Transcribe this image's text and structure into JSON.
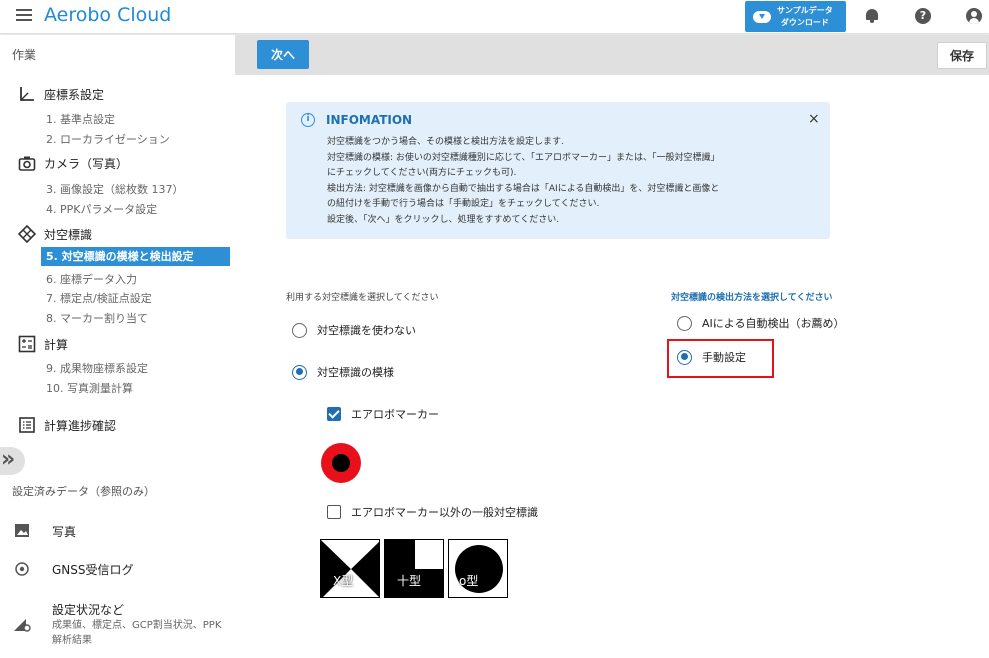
{
  "header": {
    "title": "Aerobo Cloud",
    "download_label_1": "サンプルデータ",
    "download_label_2": "ダウンロード",
    "help_glyph": "?"
  },
  "sidebar": {
    "work_title": "作業",
    "groups": [
      {
        "label": "座標系設定",
        "icon": "axis-icon",
        "items": [
          "1. 基準点設定",
          "2. ローカライゼーション"
        ]
      },
      {
        "label": "カメラ（写真）",
        "icon": "camera-icon",
        "items": [
          "3. 画像設定（総枚数 137）",
          "4. PPKパラメータ設定"
        ]
      },
      {
        "label": "対空標識",
        "icon": "target-icon",
        "items": [
          "5. 対空標識の模様と検出設定",
          "6. 座標データ入力",
          "7. 標定点/検証点設定",
          "8. マーカー割り当て"
        ]
      },
      {
        "label": "計算",
        "icon": "calculator-icon",
        "items": [
          "9. 成果物座標系設定",
          "10. 写真測量計算"
        ]
      }
    ],
    "progress_label": "計算進捗確認",
    "reference_title": "設定済みデータ（参照のみ）",
    "reference": {
      "photo": "写真",
      "gnss": "GNSS受信ログ",
      "settings": "設定状況など",
      "settings_sub": "成果値、標定点、GCP割当状況、PPK解析結果"
    }
  },
  "toolbar": {
    "next_label": "次へ",
    "save_label": "保存"
  },
  "info": {
    "title": "INFOMATION",
    "close": "×",
    "lines": [
      "対空標識をつかう場合、その模様と検出方法を設定します.",
      "対空標識の模様: お使いの対空標識種別に応じて、「エアロボマーカー」または、「一般対空標識」",
      "にチェックしてください(両方にチェックも可).",
      "検出方法: 対空標識を画像から自動で抽出する場合は「AIによる自動検出」を、対空標識と画像と",
      "の紐付けを手動で行う場合は「手動設定」をチェックしてください.",
      "設定後、「次へ」をクリックし、処理をすすめてください."
    ]
  },
  "marker_section": {
    "label": "利用する対空標識を選択してください",
    "options": [
      "対空標識を使わない",
      "対空標識の模様"
    ],
    "selected": 1,
    "aerobo_marker": "エアロボマーカー",
    "aerobo_checked": true,
    "general_marker": "エアロボマーカー以外の一般対空標識",
    "general_checked": false,
    "types": [
      "X型",
      "十型",
      "o型"
    ]
  },
  "detection_section": {
    "label": "対空標識の検出方法を選択してください",
    "options": [
      "AIによる自動検出（お薦め）",
      "手動設定"
    ],
    "selected": 1
  },
  "colors": {
    "accent": "#2d8fd6",
    "highlight": "#e4141b",
    "marker": "#e8111b"
  }
}
